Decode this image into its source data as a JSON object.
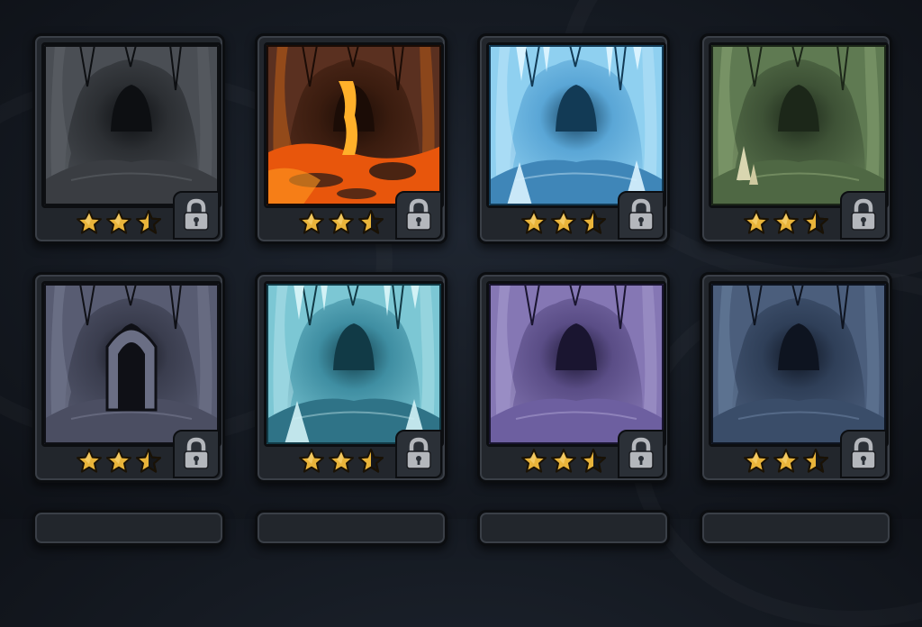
{
  "screen": {
    "title": ""
  },
  "levels": [
    {
      "theme": "stone-cave",
      "stars": 2.5,
      "locked": true,
      "colors": {
        "bg": "#2c2f33",
        "wall": "#4a4e54",
        "light": "#6d7278",
        "dark": "#0d0f12",
        "floor": "#3a3d42"
      }
    },
    {
      "theme": "lava-cave",
      "stars": 2.5,
      "locked": true,
      "colors": {
        "bg": "#3a1c0f",
        "wall": "#5a3020",
        "light": "#ff7a12",
        "dark": "#1b0c06",
        "floor": "#e8560c"
      }
    },
    {
      "theme": "ice-cave",
      "stars": 2.5,
      "locked": true,
      "colors": {
        "bg": "#5aa6d6",
        "wall": "#8fd0f0",
        "light": "#d9f3ff",
        "dark": "#123a55",
        "floor": "#3f86b8"
      }
    },
    {
      "theme": "moss-cave",
      "stars": 2.5,
      "locked": true,
      "colors": {
        "bg": "#3e5236",
        "wall": "#5f7a52",
        "light": "#a5bf8a",
        "dark": "#1c2719",
        "floor": "#4f6844"
      }
    },
    {
      "theme": "gate-cave",
      "stars": 2.5,
      "locked": true,
      "colors": {
        "bg": "#3a3d4e",
        "wall": "#585c72",
        "light": "#8a8ea6",
        "dark": "#0f1016",
        "floor": "#4b4e62"
      }
    },
    {
      "theme": "frost-cave",
      "stars": 2.5,
      "locked": true,
      "colors": {
        "bg": "#3f8ea2",
        "wall": "#7cc7d4",
        "light": "#d2f2f6",
        "dark": "#113a46",
        "floor": "#2f7387"
      }
    },
    {
      "theme": "violet-cave",
      "stars": 2.5,
      "locked": true,
      "colors": {
        "bg": "#5a4d86",
        "wall": "#8577b4",
        "light": "#c0b6e2",
        "dark": "#1a1530",
        "floor": "#6d5fa0"
      }
    },
    {
      "theme": "deep-cave",
      "stars": 2.5,
      "locked": true,
      "colors": {
        "bg": "#2f3f58",
        "wall": "#4b5e7c",
        "light": "#7f97b6",
        "dark": "#0e1420",
        "floor": "#3a4d69"
      }
    }
  ],
  "icons": {
    "star": "star-icon",
    "lock": "lock-icon"
  },
  "accent": {
    "star_fill": "#e9b43a",
    "star_shadow": "#a8761a",
    "lock": "#b4b7bc"
  }
}
